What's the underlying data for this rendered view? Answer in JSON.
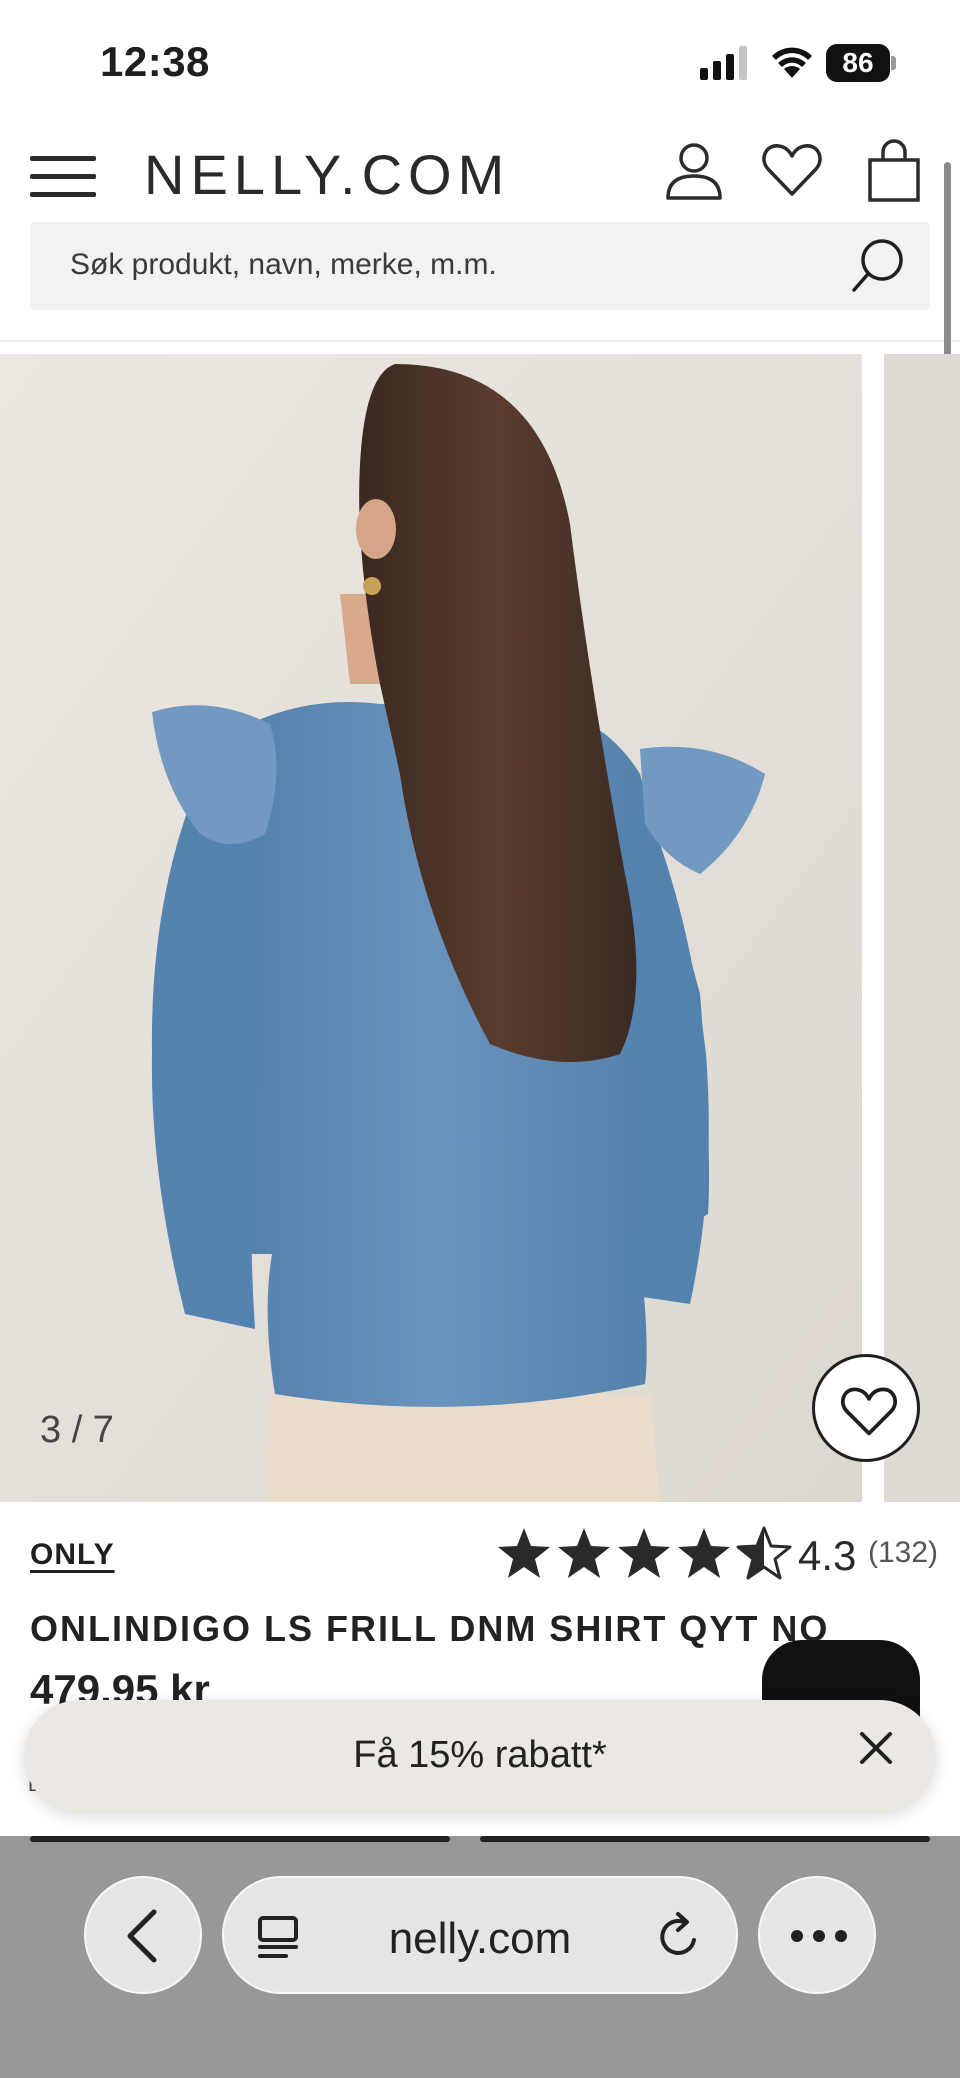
{
  "status": {
    "time": "12:38",
    "battery": "86"
  },
  "header": {
    "logo": "NELLY.COM",
    "search_placeholder": "Søk produkt, navn, merke, m.m."
  },
  "gallery": {
    "counter": "3 / 7"
  },
  "product": {
    "brand": "ONLY",
    "rating": "4.3",
    "rating_value": 4.3,
    "review_count": "(132)",
    "title": "ONLINDIGO LS FRILL DNM SHIRT QYT NO",
    "price": "479,95 kr"
  },
  "banner": {
    "text": "Få 15% rabatt*"
  },
  "browser": {
    "url": "nelly.com"
  },
  "colors": {
    "accent": "#1f1f1f",
    "banner": "#ebe8e3",
    "toolbar": "#989898",
    "denim": "#5a87b3"
  },
  "icons": [
    "hamburger-icon",
    "user-icon",
    "heart-icon",
    "bag-icon",
    "search-icon",
    "star-icon",
    "close-icon",
    "chevron-left-icon",
    "reader-icon",
    "reload-icon",
    "more-icon"
  ]
}
